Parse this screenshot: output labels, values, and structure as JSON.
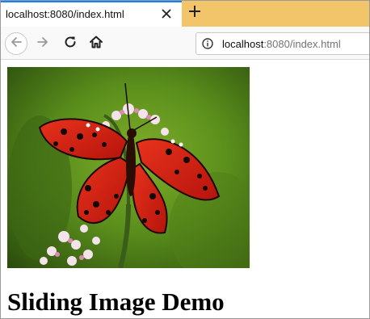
{
  "tab": {
    "title": "localhost:8080/index.html"
  },
  "toolbar": {
    "back_icon": "arrow-left-icon",
    "forward_icon": "arrow-right-icon",
    "reload_icon": "reload-icon",
    "home_icon": "home-icon",
    "new_tab_icon": "plus-icon",
    "close_tab_icon": "close-icon"
  },
  "address_bar": {
    "host": "localhost",
    "rest": ":8080/index.html"
  },
  "page": {
    "heading": "Sliding Image Demo",
    "image": "butterfly-photo"
  },
  "colors": {
    "tabstrip": "#f2c56a",
    "accent": "#0a84ff",
    "navbar": "#f9f9fa"
  }
}
